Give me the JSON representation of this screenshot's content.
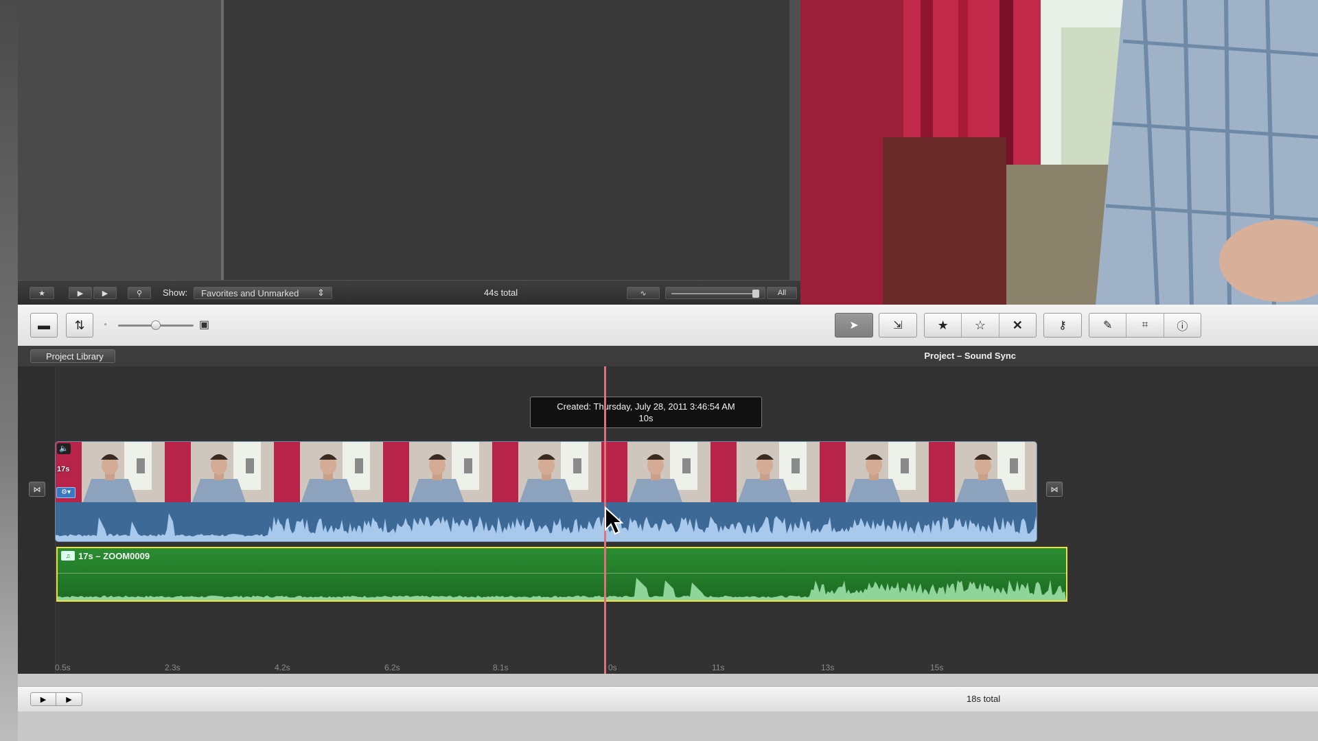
{
  "event_toolbar": {
    "show_label": "Show:",
    "show_selected": "Favorites and Unmarked",
    "total": "44s total",
    "all_label": "All"
  },
  "project_bar": {
    "library_button": "Project Library",
    "project_title": "Project – Sound Sync"
  },
  "timeline": {
    "tooltip_line1": "Created: Thursday, July 28, 2011 3:46:54 AM",
    "tooltip_line2": "10s",
    "video_clip_duration": "17s",
    "audio_clip_label": "17s – ZOOM0009",
    "ruler_labels": [
      "0.5s",
      "2.3s",
      "4.2s",
      "6.2s",
      "8.1s",
      "0s",
      "11s",
      "13s",
      "15s"
    ]
  },
  "bottom_bar": {
    "total": "18s total"
  },
  "colors": {
    "playhead": "#e0707a",
    "audio_clip_border": "#f0e23a",
    "audio_clip_fill": "#2a8d32",
    "video_audio_fill": "#3c6996"
  }
}
